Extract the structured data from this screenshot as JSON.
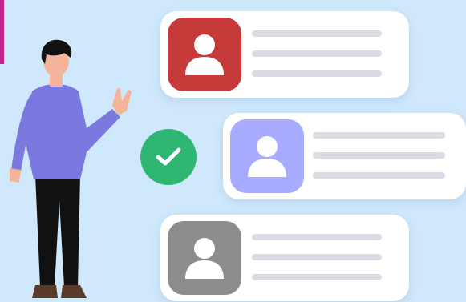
{
  "colors": {
    "background": "#cfe8fb",
    "card": "#ffffff",
    "text_line": "#d9dde3",
    "accent_bar": "#c2258f",
    "check_badge": "#2fb673"
  },
  "cards": [
    {
      "avatar_color": "#c73a3a",
      "avatar_icon": "user-icon",
      "selected": false
    },
    {
      "avatar_color": "#a9abff",
      "avatar_icon": "user-icon",
      "selected": true
    },
    {
      "avatar_color": "#8c8c8c",
      "avatar_icon": "user-icon",
      "selected": false
    }
  ],
  "check_icon": "check-icon",
  "illustration": "person-pointing"
}
